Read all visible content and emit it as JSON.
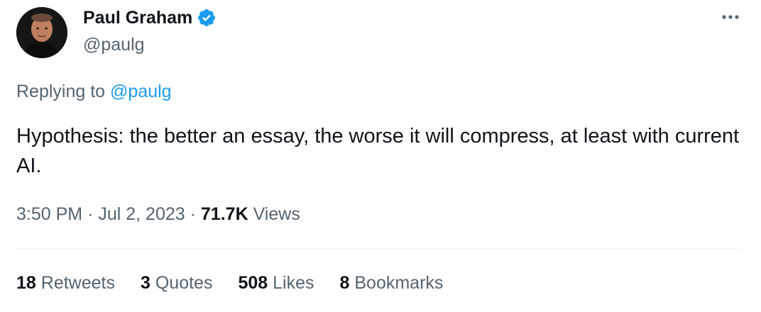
{
  "author": {
    "display_name": "Paul Graham",
    "handle": "@paulg",
    "avatar": "avatar-photo",
    "verified_icon": "verified-badge-icon",
    "verified_color": "#1d9bf0"
  },
  "more_icon": "more-horizontal-icon",
  "reply": {
    "prefix": "Replying to",
    "mention": "@paulg"
  },
  "text": "Hypothesis: the better an essay, the worse it will compress, at least with current AI.",
  "meta": {
    "time": "3:50 PM",
    "sep1": "·",
    "date": "Jul 2, 2023",
    "sep2": "·",
    "views_count": "71.7K",
    "views_label": "Views"
  },
  "stats": [
    {
      "count": "18",
      "label": "Retweets"
    },
    {
      "count": "3",
      "label": "Quotes"
    },
    {
      "count": "508",
      "label": "Likes"
    },
    {
      "count": "8",
      "label": "Bookmarks"
    }
  ],
  "colors": {
    "text": "#0f1419",
    "secondary": "#536471",
    "link": "#1d9bf0",
    "divider": "#eff3f4"
  }
}
